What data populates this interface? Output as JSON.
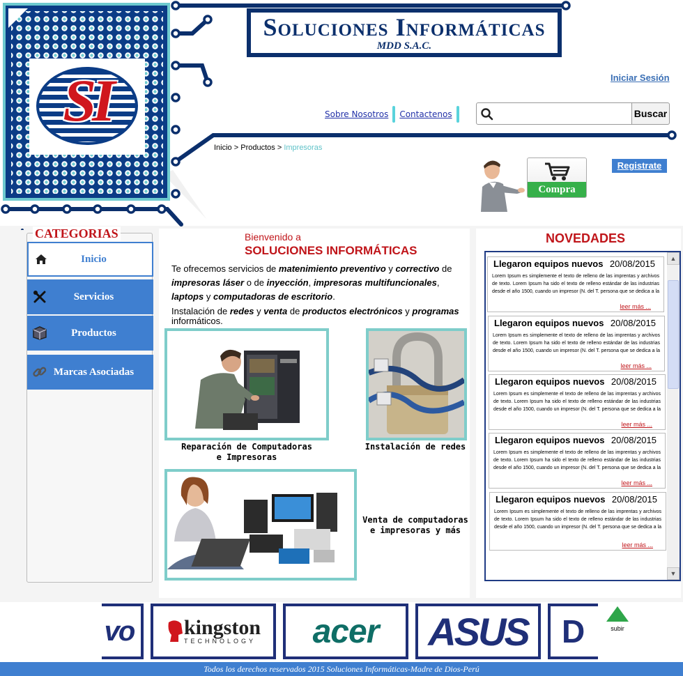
{
  "header": {
    "logo_text": "SI",
    "banner_title": "Soluciones Informáticas",
    "banner_subtitle": "MDD S.A.C.",
    "login_link": "Iniciar Sesión",
    "nav": [
      "Sobre Nosotros",
      "Contactenos"
    ],
    "search": {
      "button": "Buscar",
      "value": ""
    },
    "breadcrumb": {
      "home": "Inicio",
      "sep": " > ",
      "products": "Productos",
      "current": "Impresoras"
    },
    "cart_label": "Compra",
    "register_link": "Registrate"
  },
  "sidebar": {
    "title": "CATEGORIAS",
    "items": [
      {
        "label": "Inicio",
        "icon": "home-icon",
        "active": true
      },
      {
        "label": "Servicios",
        "icon": "tools-icon"
      },
      {
        "label": "Productos",
        "icon": "box-icon"
      },
      {
        "label": "Marcas Asociadas",
        "icon": "link-icon"
      }
    ]
  },
  "main": {
    "welcome": "Bienvenido a",
    "welcome_title": "SOLUCIONES INFORMÁTICAS",
    "intro": {
      "p1_a": "Te ofrecemos servicios de ",
      "p1_b": "matenimiento preventivo",
      "p1_c": " y ",
      "p1_d": "correctivo",
      "p1_e": " de ",
      "p1_f": "impresoras láser",
      "p1_g": " o de ",
      "p1_h": "inyección",
      "p1_i": ", ",
      "p1_j": "impresoras multifuncionales",
      "p1_k": ", ",
      "p1_l": "laptops",
      "p1_m": " y ",
      "p1_n": "computadoras de escritorio",
      "p1_o": ".",
      "p2_a": "Instalación de ",
      "p2_b": "redes",
      "p2_c": " y ",
      "p2_d": "venta",
      "p2_e": " de ",
      "p2_f": "productos electrónicos",
      "p2_g": " y ",
      "p2_h": "programas",
      "p2_i": " informáticos."
    },
    "services": [
      {
        "caption_1": "Reparación de Computadoras",
        "caption_2": "e Impresoras"
      },
      {
        "caption_1": "Instalación de redes"
      },
      {
        "caption_1": "Venta de computadoras",
        "caption_2": "e impresoras y más"
      }
    ]
  },
  "news": {
    "title": "NOVEDADES",
    "items": [
      {
        "headline": "Llegaron equipos nuevos",
        "date": "20/08/2015",
        "body": "Lorem Ipsum es simplemente el texto de relleno de las imprentas y archivos de texto. Lorem Ipsum ha sido el texto de relleno estándar de las industrias desde el año 1500, cuando un impresor (N. del T. persona que se dedica a la imprenta) desconocido usó una galería de",
        "more": "leer más ..."
      },
      {
        "headline": "Llegaron equipos nuevos",
        "date": "20/08/2015",
        "body": "Lorem Ipsum es simplemente el texto de relleno de las imprentas y archivos de texto. Lorem Ipsum ha sido el texto de relleno estándar de las industrias desde el año 1500, cuando un impresor (N. del T. persona que se dedica a la imprenta) desconocido usó una galería de",
        "more": "leer más ..."
      },
      {
        "headline": "Llegaron equipos nuevos",
        "date": "20/08/2015",
        "body": "Lorem Ipsum es simplemente el texto de relleno de las imprentas y archivos de texto. Lorem Ipsum ha sido el texto de relleno estándar de las industrias desde el año 1500, cuando un impresor (N. del T. persona que se dedica a la imprenta) desconocido usó una galería de",
        "more": "leer más ..."
      },
      {
        "headline": "Llegaron equipos nuevos",
        "date": "20/08/2015",
        "body": "Lorem Ipsum es simplemente el texto de relleno de las imprentas y archivos de texto. Lorem Ipsum ha sido el texto de relleno estándar de las industrias desde el año 1500, cuando un impresor (N. del T. persona que se dedica a la imprenta) desconocido usó una galería de",
        "more": "leer más ..."
      },
      {
        "headline": "Llegaron equipos nuevos",
        "date": "20/08/2015",
        "body": "Lorem Ipsum es simplemente el texto de relleno de las imprentas y archivos de texto. Lorem Ipsum ha sido el texto de relleno estándar de las industrias desde el año 1500, cuando un impresor (N. del T. persona que se dedica a la imprenta) desconocido usó una galería de",
        "more": "leer más ..."
      }
    ]
  },
  "brands": [
    "vo",
    "kingston",
    "TECHNOLOGY",
    "acer",
    "ASUS",
    "D"
  ],
  "subir_label": "subir",
  "footer": "Todos los derechos reservados 2015 Soluciones Informáticas-Madre de Dios-Perú",
  "colors": {
    "brand_red": "#c0151a",
    "brand_navy": "#0b3c86",
    "accent_blue": "#3f7fd0",
    "teal": "#6dcacf",
    "cart_green": "#36b04a"
  }
}
